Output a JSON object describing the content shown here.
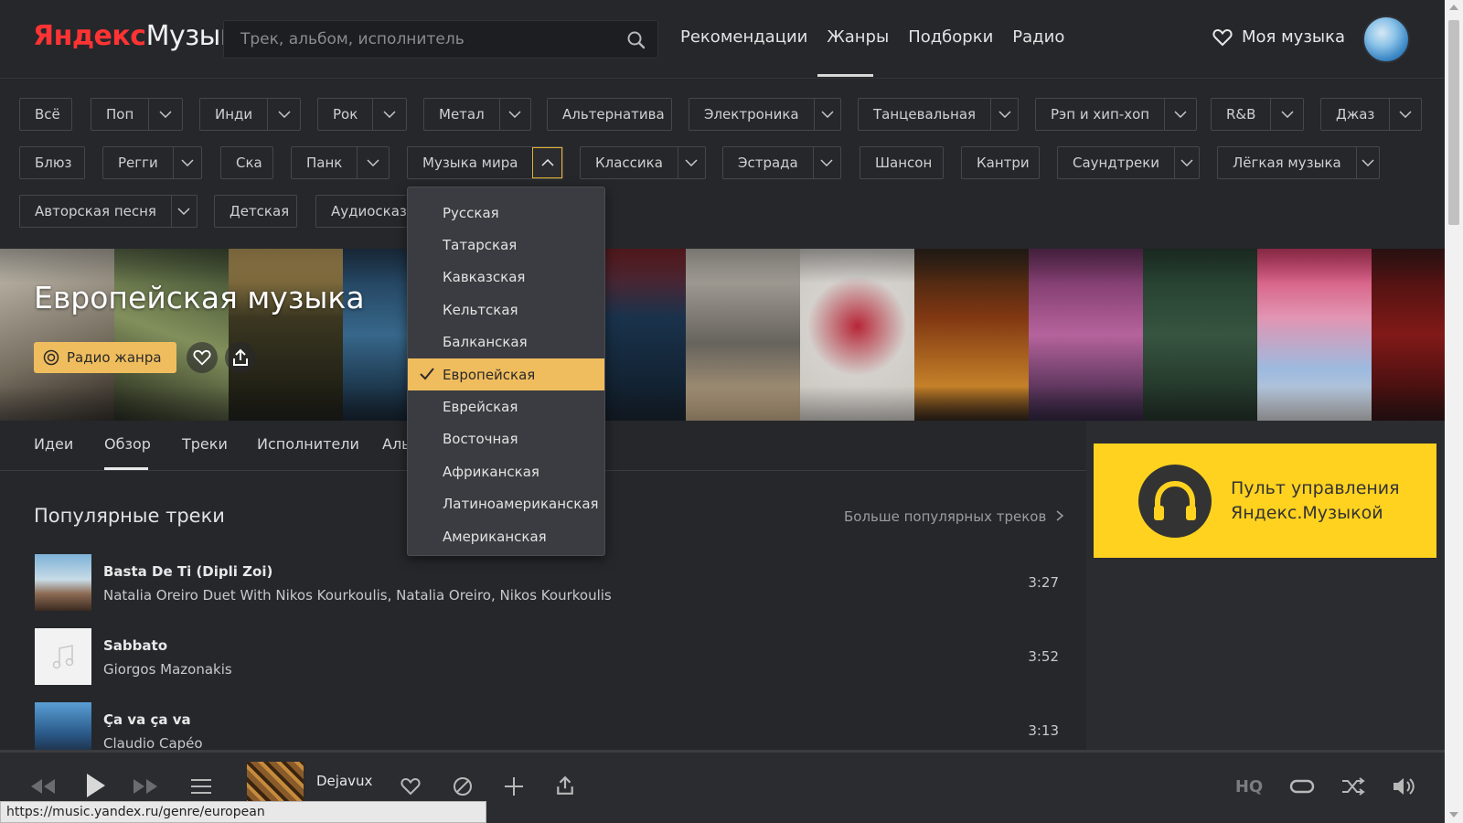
{
  "header": {
    "logo_brand": "Яндекс",
    "logo_product": "Музыка",
    "search_placeholder": "Трек, альбом, исполнитель",
    "nav": [
      "Рекомендации",
      "Жанры",
      "Подборки",
      "Радио"
    ],
    "active_nav": "Жанры",
    "my_music": "Моя музыка"
  },
  "genres": {
    "row1": [
      {
        "label": "Всё",
        "has_menu": false
      },
      {
        "label": "Поп",
        "has_menu": true
      },
      {
        "label": "Инди",
        "has_menu": true
      },
      {
        "label": "Рок",
        "has_menu": true
      },
      {
        "label": "Метал",
        "has_menu": true
      },
      {
        "label": "Альтернатива",
        "has_menu": false
      },
      {
        "label": "Электроника",
        "has_menu": true
      },
      {
        "label": "Танцевальная",
        "has_menu": true
      },
      {
        "label": "Рэп и хип-хоп",
        "has_menu": true
      },
      {
        "label": "R&B",
        "has_menu": true
      },
      {
        "label": "Джаз",
        "has_menu": true
      }
    ],
    "row2": [
      {
        "label": "Блюз",
        "has_menu": false
      },
      {
        "label": "Регги",
        "has_menu": true
      },
      {
        "label": "Ска",
        "has_menu": false
      },
      {
        "label": "Панк",
        "has_menu": true
      },
      {
        "label": "Музыка мира",
        "has_menu": true,
        "open": true
      },
      {
        "label": "Классика",
        "has_menu": true
      },
      {
        "label": "Эстрада",
        "has_menu": true
      },
      {
        "label": "Шансон",
        "has_menu": false
      },
      {
        "label": "Кантри",
        "has_menu": false
      },
      {
        "label": "Саундтреки",
        "has_menu": true
      },
      {
        "label": "Лёгкая музыка",
        "has_menu": true
      }
    ],
    "row3": [
      {
        "label": "Авторская песня",
        "has_menu": true
      },
      {
        "label": "Детская",
        "has_menu": false
      },
      {
        "label": "Аудиосказки",
        "has_menu": false
      }
    ]
  },
  "dropdown": {
    "items": [
      "Русская",
      "Татарская",
      "Кавказская",
      "Кельтская",
      "Балканская",
      "Европейская",
      "Еврейская",
      "Восточная",
      "Африканская",
      "Латиноамериканская",
      "Американская"
    ],
    "selected": "Европейская"
  },
  "banner": {
    "title": "Европейская музыка",
    "radio_button": "Радио жанра"
  },
  "tabs": [
    "Идеи",
    "Обзор",
    "Треки",
    "Исполнители",
    "Альбомы"
  ],
  "active_tab": "Обзор",
  "popular": {
    "title": "Популярные треки",
    "more_link": "Больше популярных треков",
    "tracks": [
      {
        "title": "Basta De Ti (Dipli Zoi)",
        "artist": "Natalia Oreiro Duet With Nikos Kourkoulis, Natalia Oreiro, Nikos Kourkoulis",
        "duration": "3:27"
      },
      {
        "title": "Sabbato",
        "artist": "Giorgos Mazonakis",
        "duration": "3:52"
      },
      {
        "title": "Ça va ça va",
        "artist": "Claudio Capéo",
        "duration": "3:13"
      }
    ]
  },
  "promo": {
    "line1": "Пульт управления",
    "line2": "Яндекс.Музыкой"
  },
  "player": {
    "track_title": "Dejavux",
    "hq_label": "HQ"
  },
  "status_url": "https://music.yandex.ru/genre/european",
  "colors": {
    "background": "#25272b",
    "accent": "#f0bd5e",
    "promo": "#ffd21f",
    "logo_red": "#ff3333"
  }
}
